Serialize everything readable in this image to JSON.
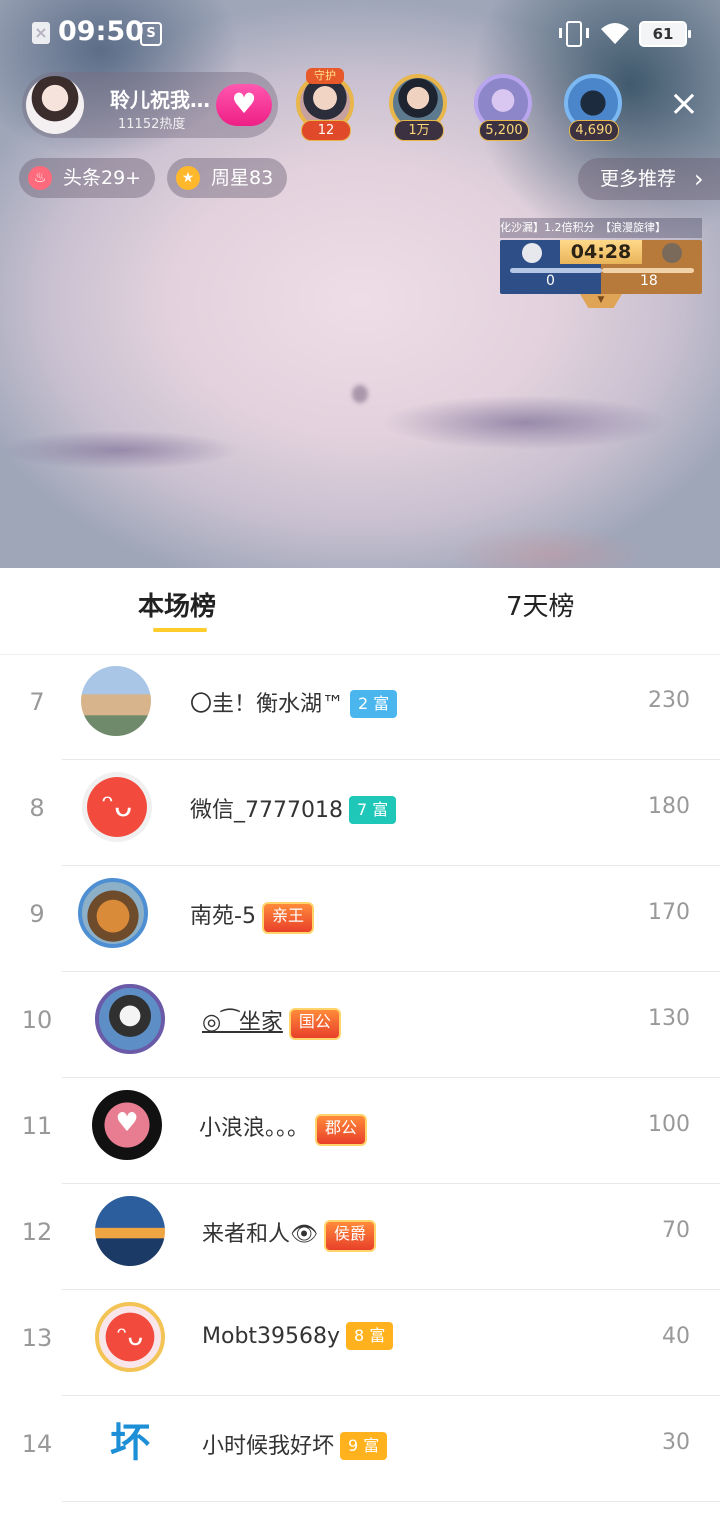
{
  "status": {
    "time": "09:50",
    "battery": "61"
  },
  "host": {
    "name": "聆儿祝我…",
    "heat": "11152热度"
  },
  "top_viewers": [
    {
      "badge": "12",
      "crown": "守护"
    },
    {
      "badge": "1万"
    },
    {
      "badge": "5,200"
    },
    {
      "badge": "4,690"
    }
  ],
  "pills": {
    "headline": "头条29+",
    "weekly_star": "周星83",
    "more": "更多推荐"
  },
  "pk": {
    "banner": "化沙漏】1.2倍积分　【浪漫旋律】",
    "timer": "04:28",
    "left_score": "0",
    "right_score": "18"
  },
  "tabs": {
    "current": "本场榜",
    "week": "7天榜"
  },
  "ranking": [
    {
      "rank": "7",
      "name": "〇圭！衡水湖™",
      "level": "2 富",
      "level_color": "#4bb6ee",
      "points": "230"
    },
    {
      "rank": "8",
      "name": "微信_7777018",
      "level": "7 富",
      "level_color": "#1ec7b7",
      "points": "180"
    },
    {
      "rank": "9",
      "name": "南苑-5",
      "level": "亲王",
      "level_color": "#e8402a",
      "points": "170"
    },
    {
      "rank": "10",
      "name": "◎⁀坐家",
      "level": "国公",
      "level_color": "#e8402a",
      "points": "130"
    },
    {
      "rank": "11",
      "name": "小浪浪。。。",
      "level": "郡公",
      "level_color": "#e8402a",
      "points": "100"
    },
    {
      "rank": "12",
      "name": "来者和人👁",
      "level": "侯爵",
      "level_color": "#e8402a",
      "points": "70"
    },
    {
      "rank": "13",
      "name": "Mobt39568y",
      "level": "8 富",
      "level_color": "#ffb21e",
      "points": "40"
    },
    {
      "rank": "14",
      "name": "小时候我好坏",
      "level": "9 富",
      "level_color": "#ffb21e",
      "points": "30"
    }
  ]
}
